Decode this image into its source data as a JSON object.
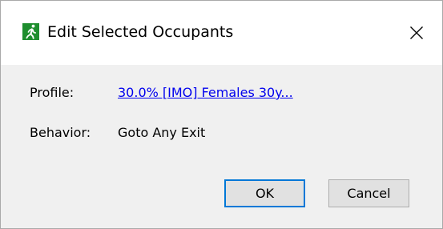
{
  "window": {
    "title": "Edit Selected Occupants",
    "icon": "running-person-exit-icon",
    "icon_color": "#1e8e2e"
  },
  "fields": {
    "profile_label": "Profile:",
    "profile_value": "30.0% [IMO] Females 30y...",
    "behavior_label": "Behavior:",
    "behavior_value": "Goto Any Exit"
  },
  "buttons": {
    "ok_label": "OK",
    "cancel_label": "Cancel"
  },
  "colors": {
    "link": "#0000ee",
    "focus_border": "#0078d7",
    "dialog_bg": "#f0f0f0"
  }
}
